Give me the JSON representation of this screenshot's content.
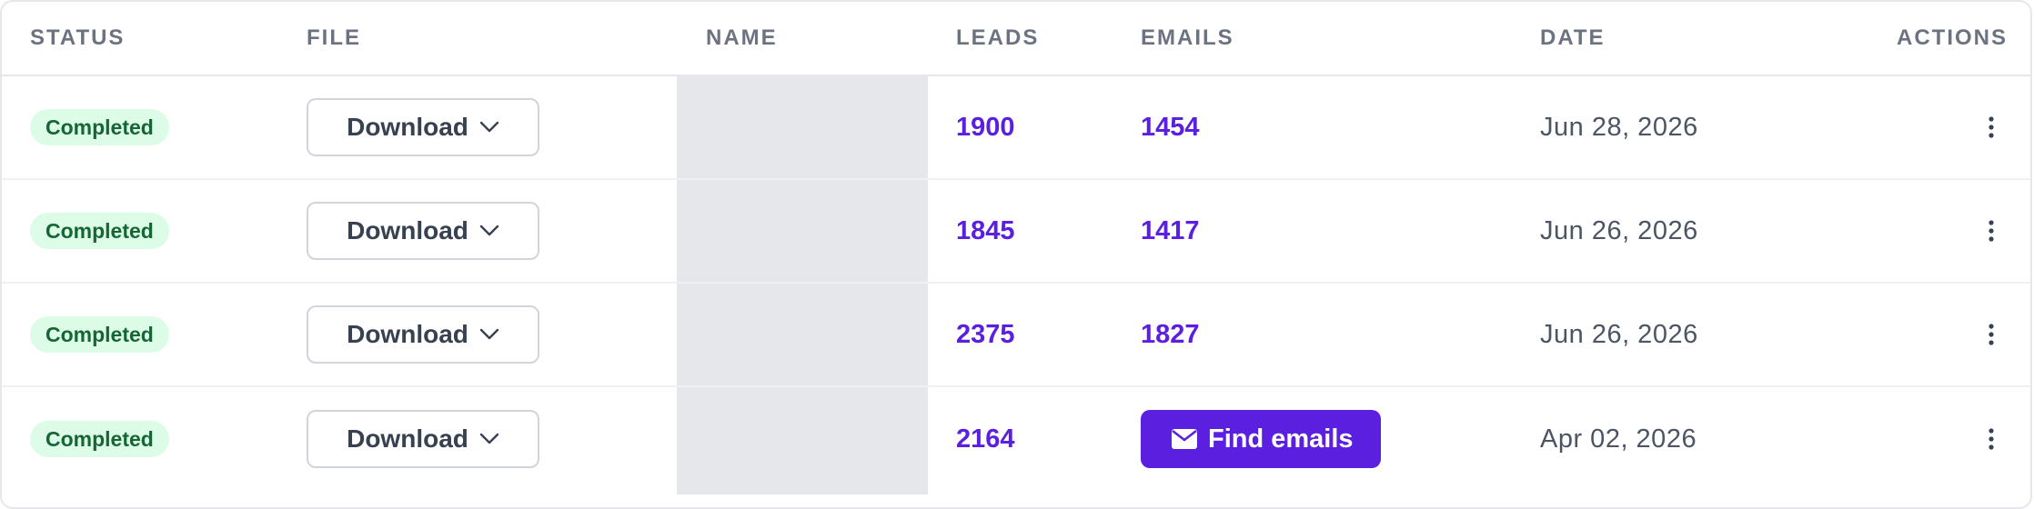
{
  "table": {
    "headers": {
      "status": "STATUS",
      "file": "FILE",
      "name": "NAME",
      "leads": "LEADS",
      "emails": "EMAILS",
      "date": "DATE",
      "actions": "ACTIONS"
    },
    "rows": [
      {
        "status": "Completed",
        "file_button": "Download",
        "name": "",
        "leads": "1900",
        "emails": "1454",
        "date": "Jun 28, 2026"
      },
      {
        "status": "Completed",
        "file_button": "Download",
        "name": "",
        "leads": "1845",
        "emails": "1417",
        "date": "Jun 26, 2026"
      },
      {
        "status": "Completed",
        "file_button": "Download",
        "name": "",
        "leads": "2375",
        "emails": "1827",
        "date": "Jun 26, 2026"
      },
      {
        "status": "Completed",
        "file_button": "Download",
        "name": "",
        "leads": "2164",
        "emails_button": "Find emails",
        "date": "Apr 02, 2026"
      }
    ]
  },
  "icons": {
    "download_dropdown": "chevron-down-icon",
    "find_emails": "envelope-icon",
    "row_actions": "kebab-menu-icon"
  },
  "colors": {
    "accent": "#5b1fe0",
    "status_badge_bg": "#dcfce7",
    "status_badge_text": "#166534",
    "header_text": "#6b7280",
    "border": "#e5e7eb",
    "name_placeholder": "#e5e7eb"
  }
}
